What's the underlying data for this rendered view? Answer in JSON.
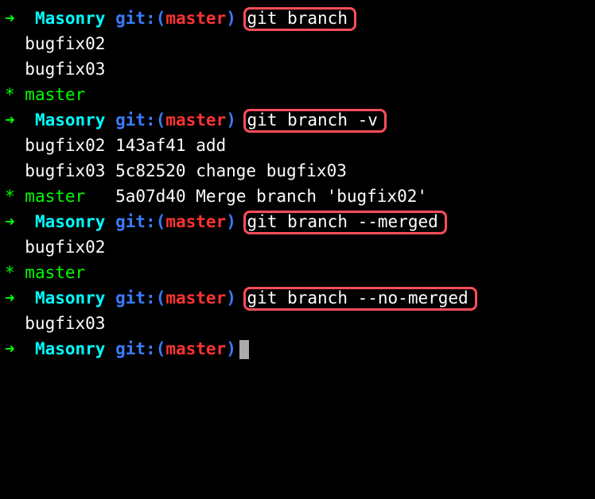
{
  "prompt": {
    "arrow": "➜",
    "dir": "Masonry",
    "git_label": "git:",
    "paren_open": "(",
    "branch": "master",
    "paren_close": ")"
  },
  "commands": {
    "c1": "git branch",
    "c2": "git branch -v",
    "c3": "git branch --merged",
    "c4": "git branch --no-merged"
  },
  "output": {
    "block1": {
      "l1": "  bugfix02",
      "l2": "  bugfix03",
      "star": "*",
      "l3": " master"
    },
    "block2": {
      "l1": "  bugfix02 143af41 add",
      "l2": "  bugfix03 5c82520 change bugfix03",
      "star": "*",
      "l3_green": " master  ",
      "l3_white": " 5a07d40 Merge branch 'bugfix02'"
    },
    "block3": {
      "l1": "  bugfix02",
      "star": "*",
      "l2": " master"
    },
    "block4": {
      "l1": "  bugfix03"
    }
  }
}
